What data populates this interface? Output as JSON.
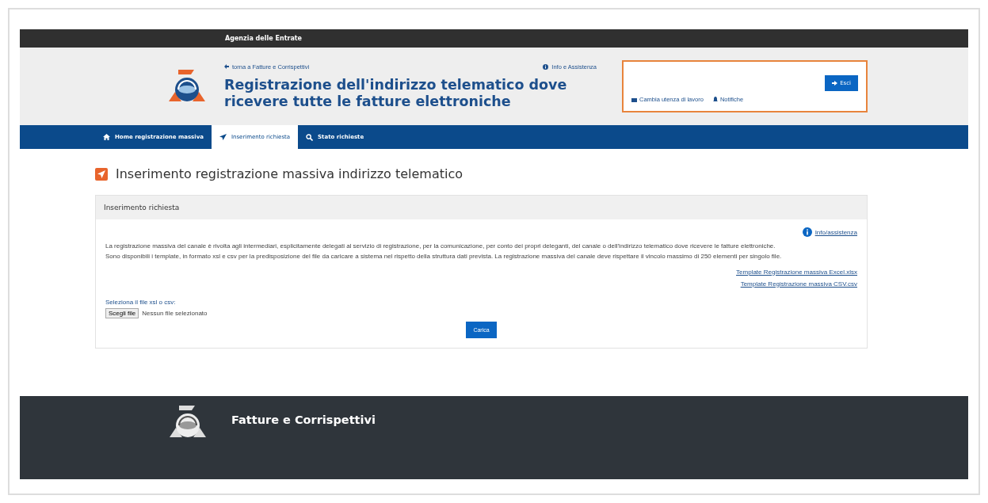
{
  "top_bar": {
    "title": "Agenzia delle Entrate"
  },
  "header": {
    "back_link": "torna a Fatture e Corrispettivi",
    "info_link": "Info e Assistenza",
    "title": "Registrazione dell'indirizzo telematico dove ricevere tutte le fatture elettroniche",
    "user_box": {
      "change_user": "Cambia utenza di lavoro",
      "notifications": "Notifiche",
      "logout": "Esci"
    }
  },
  "tabs": [
    {
      "label": "Home registrazione massiva",
      "selected": false
    },
    {
      "label": "Inserimento richiesta",
      "selected": true
    },
    {
      "label": "Stato richieste",
      "selected": false
    }
  ],
  "page_title": "Inserimento registrazione massiva indirizzo telematico",
  "panel": {
    "title": "Inserimento richiesta",
    "help_link": "Info/assistenza",
    "paragraphs": [
      "La registrazione massiva del canale è rivolta agli intermediari, esplicitamente delegati al servizio di registrazione, per la comunicazione, per conto dei propri deleganti, del canale o dell'indirizzo telematico dove ricevere le fatture elettroniche.",
      "Sono disponibili i template, in formato xsl e csv per la predisposizione del file da caricare a sistema nel rispetto della struttura dati prevista. La registrazione massiva del canale deve rispettare il vincolo massimo di 250 elementi per singolo file."
    ],
    "templates": [
      "Template Registrazione massiva Excel.xlsx",
      "Template Registrazione massiva CSV.csv"
    ],
    "file_label": "Seleziona il file xsl o csv:",
    "file_button": "Scegli file",
    "file_status": "Nessun file selezionato",
    "upload_button": "Carica"
  },
  "footer": {
    "title": "Fatture e Corrispettivi"
  }
}
